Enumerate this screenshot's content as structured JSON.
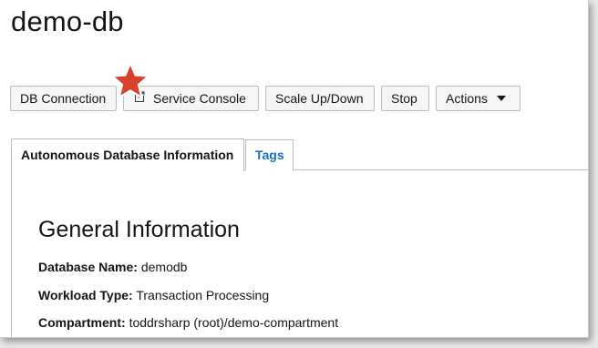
{
  "page": {
    "title": "demo-db"
  },
  "toolbar": {
    "db_connection": "DB Connection",
    "service_console": "Service Console",
    "scale": "Scale Up/Down",
    "stop": "Stop",
    "actions": "Actions"
  },
  "tabs": [
    {
      "label": "Autonomous Database Information",
      "selected": true
    },
    {
      "label": "Tags",
      "selected": false
    }
  ],
  "general": {
    "heading": "General Information",
    "rows": [
      {
        "label": "Database Name:",
        "value": "demodb"
      },
      {
        "label": "Workload Type:",
        "value": "Transaction Processing"
      },
      {
        "label": "Compartment:",
        "value": "toddrsharp (root)/demo-compartment"
      }
    ]
  },
  "icons": {
    "service_console": "external-link-icon",
    "actions": "caret-down-icon",
    "highlight": "star-icon"
  },
  "colors": {
    "link": "#1a6ec1",
    "star": "#d9412b",
    "button_bg": "#f5f5f5",
    "border": "#bdbdbd"
  }
}
